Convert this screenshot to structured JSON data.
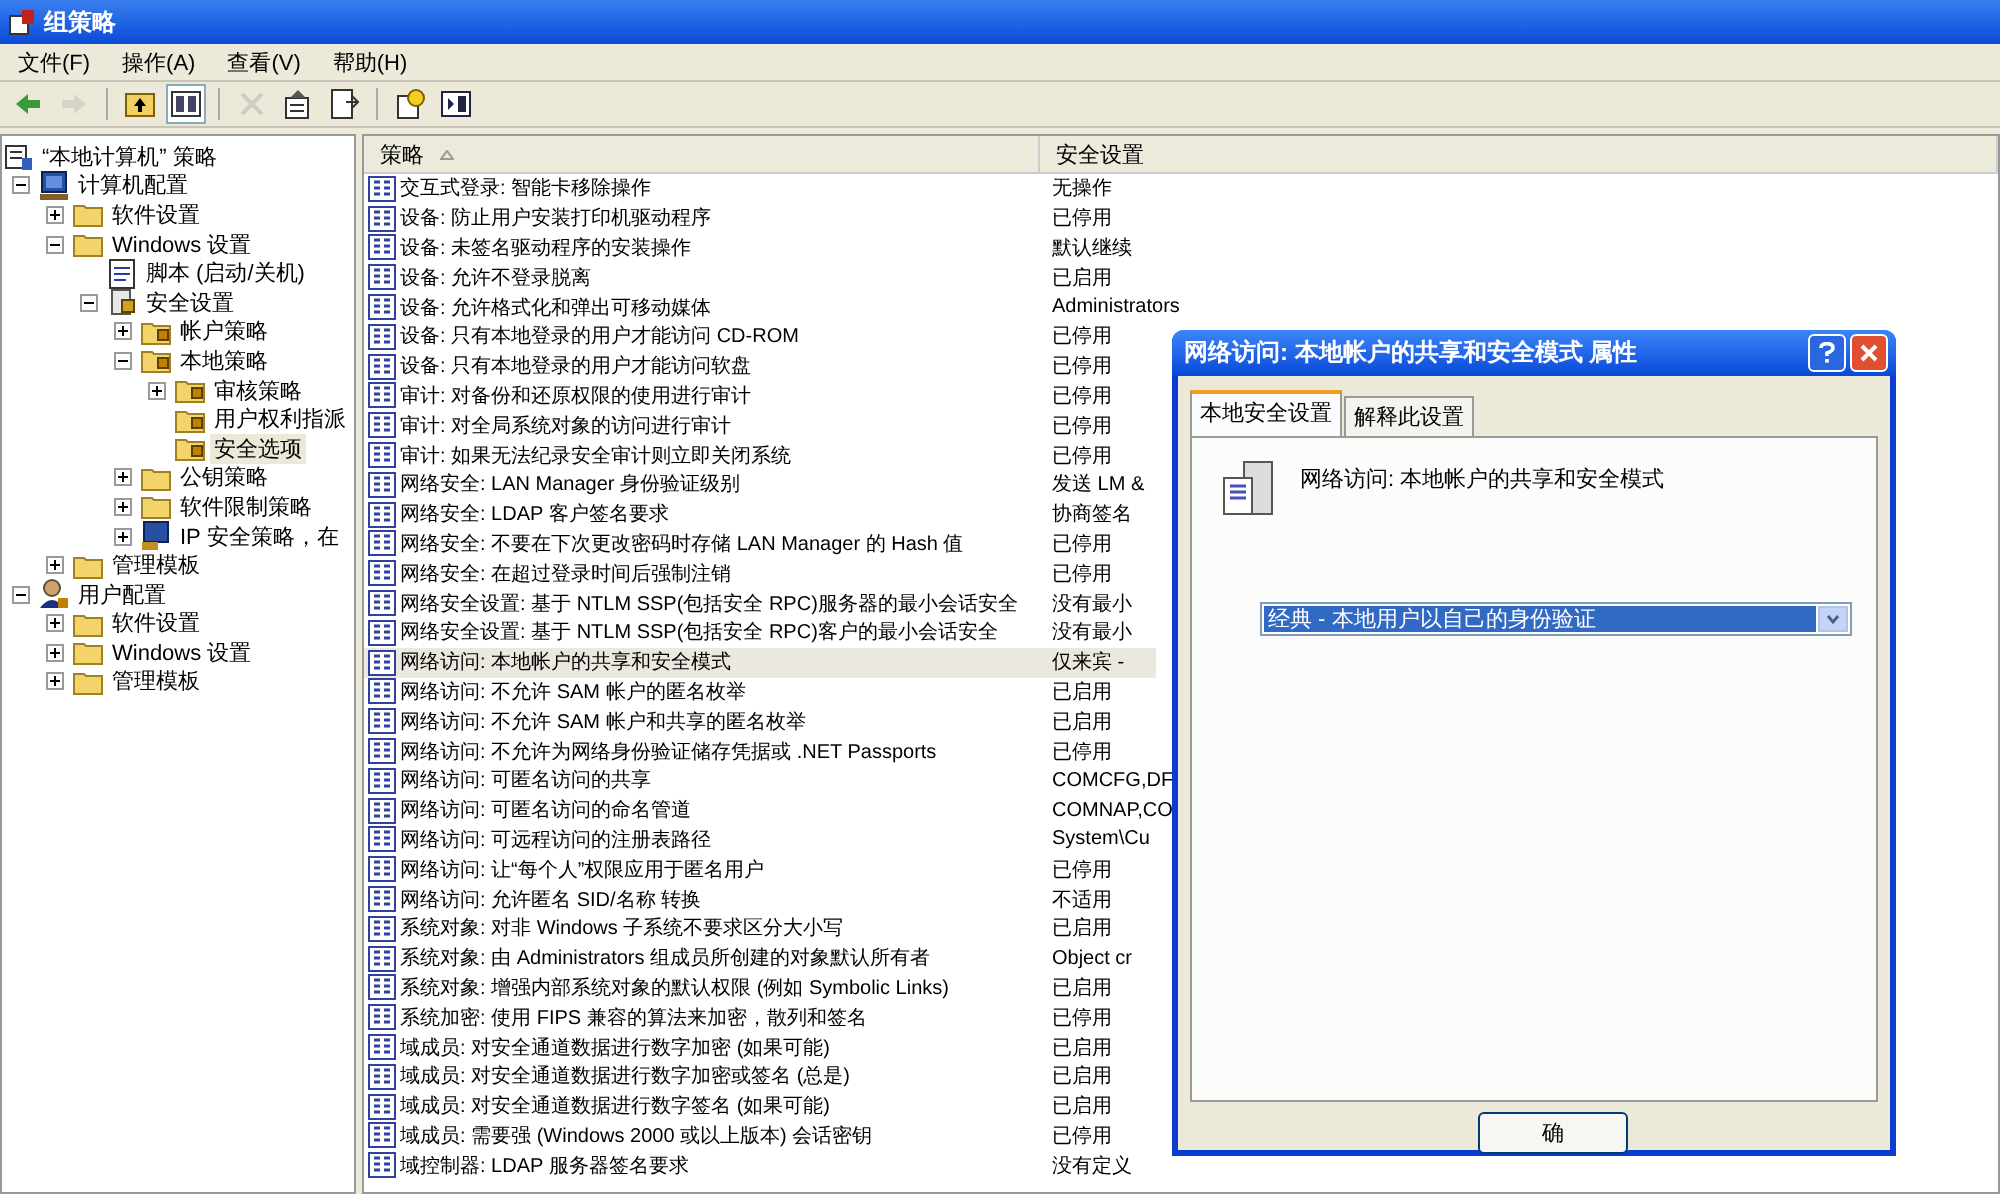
{
  "window": {
    "title": "组策略"
  },
  "menu": [
    "文件(F)",
    "操作(A)",
    "查看(V)",
    "帮助(H)"
  ],
  "toolbar": [
    {
      "kind": "back",
      "disabled": false,
      "pressed": false
    },
    {
      "kind": "forward",
      "disabled": true,
      "pressed": false
    },
    {
      "kind": "up",
      "disabled": false,
      "pressed": false
    },
    {
      "kind": "tree",
      "disabled": false,
      "pressed": true
    },
    {
      "kind": "delete",
      "disabled": true,
      "pressed": false
    },
    {
      "kind": "properties",
      "disabled": false,
      "pressed": false
    },
    {
      "kind": "export",
      "disabled": false,
      "pressed": false
    },
    {
      "kind": "help",
      "disabled": false,
      "pressed": false
    },
    {
      "kind": "panel",
      "disabled": false,
      "pressed": false
    }
  ],
  "tree": [
    {
      "label": "“本地计算机” 策略",
      "kind": "policy",
      "selected": false,
      "children": [
        {
          "label": "计算机配置",
          "kind": "computer",
          "expanded": true,
          "selected": false,
          "children": [
            {
              "label": "软件设置",
              "kind": "folder",
              "expanded": false,
              "selected": false
            },
            {
              "label": "Windows 设置",
              "kind": "folder",
              "expanded": true,
              "selected": false,
              "children": [
                {
                  "label": "脚本 (启动/关机)",
                  "kind": "script",
                  "selected": false
                },
                {
                  "label": "安全设置",
                  "kind": "security",
                  "expanded": true,
                  "selected": false,
                  "children": [
                    {
                      "label": "帐户策略",
                      "kind": "lockfolder",
                      "expanded": false,
                      "selected": false
                    },
                    {
                      "label": "本地策略",
                      "kind": "lockfolder",
                      "expanded": true,
                      "selected": false,
                      "children": [
                        {
                          "label": "审核策略",
                          "kind": "lockfolder",
                          "expanded": false,
                          "selected": false
                        },
                        {
                          "label": "用户权利指派",
                          "kind": "lockfolder",
                          "selected": false
                        },
                        {
                          "label": "安全选项",
                          "kind": "lockfolder",
                          "selected": true
                        }
                      ]
                    },
                    {
                      "label": "公钥策略",
                      "kind": "folder",
                      "expanded": false,
                      "selected": false
                    },
                    {
                      "label": "软件限制策略",
                      "kind": "folder",
                      "expanded": false,
                      "selected": false
                    },
                    {
                      "label": "IP 安全策略，在",
                      "kind": "ip",
                      "expanded": false,
                      "selected": false
                    }
                  ]
                }
              ]
            },
            {
              "label": "管理模板",
              "kind": "folder",
              "expanded": false,
              "selected": false
            }
          ]
        },
        {
          "label": "用户配置",
          "kind": "user",
          "expanded": true,
          "selected": false,
          "children": [
            {
              "label": "软件设置",
              "kind": "folder",
              "expanded": false,
              "selected": false
            },
            {
              "label": "Windows 设置",
              "kind": "folder",
              "expanded": false,
              "selected": false
            },
            {
              "label": "管理模板",
              "kind": "folder",
              "expanded": false,
              "selected": false
            }
          ]
        }
      ]
    }
  ],
  "table": {
    "columns": [
      "策略",
      "安全设置"
    ],
    "rows": [
      {
        "policy": "交互式登录: 智能卡移除操作",
        "setting": "无操作",
        "selected": false
      },
      {
        "policy": "设备: 防止用户安装打印机驱动程序",
        "setting": "已停用",
        "selected": false
      },
      {
        "policy": "设备: 未签名驱动程序的安装操作",
        "setting": "默认继续",
        "selected": false
      },
      {
        "policy": "设备: 允许不登录脱离",
        "setting": "已启用",
        "selected": false
      },
      {
        "policy": "设备: 允许格式化和弹出可移动媒体",
        "setting": "Administrators",
        "selected": false
      },
      {
        "policy": "设备: 只有本地登录的用户才能访问 CD-ROM",
        "setting": "已停用",
        "selected": false
      },
      {
        "policy": "设备: 只有本地登录的用户才能访问软盘",
        "setting": "已停用",
        "selected": false
      },
      {
        "policy": "审计: 对备份和还原权限的使用进行审计",
        "setting": "已停用",
        "selected": false
      },
      {
        "policy": "审计: 对全局系统对象的访问进行审计",
        "setting": "已停用",
        "selected": false
      },
      {
        "policy": "审计: 如果无法纪录安全审计则立即关闭系统",
        "setting": "已停用",
        "selected": false
      },
      {
        "policy": "网络安全: LAN Manager 身份验证级别",
        "setting": "发送 LM &",
        "selected": false
      },
      {
        "policy": "网络安全: LDAP 客户签名要求",
        "setting": "协商签名",
        "selected": false
      },
      {
        "policy": "网络安全: 不要在下次更改密码时存储 LAN Manager 的 Hash 值",
        "setting": "已停用",
        "selected": false
      },
      {
        "policy": "网络安全: 在超过登录时间后强制注销",
        "setting": "已停用",
        "selected": false
      },
      {
        "policy": "网络安全设置: 基于 NTLM SSP(包括安全 RPC)服务器的最小会话安全",
        "setting": "没有最小",
        "selected": false
      },
      {
        "policy": "网络安全设置: 基于 NTLM SSP(包括安全 RPC)客户的最小会话安全",
        "setting": "没有最小",
        "selected": false
      },
      {
        "policy": "网络访问: 本地帐户的共享和安全模式",
        "setting": "仅来宾 -",
        "selected": true
      },
      {
        "policy": "网络访问: 不允许 SAM 帐户的匿名枚举",
        "setting": "已启用",
        "selected": false
      },
      {
        "policy": "网络访问: 不允许 SAM 帐户和共享的匿名枚举",
        "setting": "已启用",
        "selected": false
      },
      {
        "policy": "网络访问: 不允许为网络身份验证储存凭据或 .NET Passports",
        "setting": "已停用",
        "selected": false
      },
      {
        "policy": "网络访问: 可匿名访问的共享",
        "setting": "COMCFG,DF",
        "selected": false
      },
      {
        "policy": "网络访问: 可匿名访问的命名管道",
        "setting": "COMNAP,CO",
        "selected": false
      },
      {
        "policy": "网络访问: 可远程访问的注册表路径",
        "setting": "System\\Cu",
        "selected": false
      },
      {
        "policy": "网络访问: 让“每个人”权限应用于匿名用户",
        "setting": "已停用",
        "selected": false
      },
      {
        "policy": "网络访问: 允许匿名 SID/名称 转换",
        "setting": "不适用",
        "selected": false
      },
      {
        "policy": "系统对象: 对非 Windows 子系统不要求区分大小写",
        "setting": "已启用",
        "selected": false
      },
      {
        "policy": "系统对象: 由 Administrators 组成员所创建的对象默认所有者",
        "setting": "Object cr",
        "selected": false
      },
      {
        "policy": "系统对象: 增强内部系统对象的默认权限 (例如 Symbolic Links)",
        "setting": "已启用",
        "selected": false
      },
      {
        "policy": "系统加密: 使用 FIPS 兼容的算法来加密，散列和签名",
        "setting": "已停用",
        "selected": false
      },
      {
        "policy": "域成员: 对安全通道数据进行数字加密 (如果可能)",
        "setting": "已启用",
        "selected": false
      },
      {
        "policy": "域成员: 对安全通道数据进行数字加密或签名 (总是)",
        "setting": "已启用",
        "selected": false
      },
      {
        "policy": "域成员: 对安全通道数据进行数字签名 (如果可能)",
        "setting": "已启用",
        "selected": false
      },
      {
        "policy": "域成员: 需要强 (Windows 2000 或以上版本) 会话密钥",
        "setting": "已停用",
        "selected": false
      },
      {
        "policy": "域控制器: LDAP 服务器签名要求",
        "setting": "没有定义",
        "selected": false
      }
    ]
  },
  "dialog": {
    "title": "网络访问: 本地帐户的共享和安全模式 属性",
    "tabs": [
      {
        "label": "本地安全设置",
        "selected": true
      },
      {
        "label": "解释此设置",
        "selected": false
      }
    ],
    "heading": "网络访问: 本地帐户的共享和安全模式",
    "dropdown": {
      "value": "经典 - 本地用户以自己的身份验证"
    },
    "buttons": [
      "确"
    ]
  }
}
